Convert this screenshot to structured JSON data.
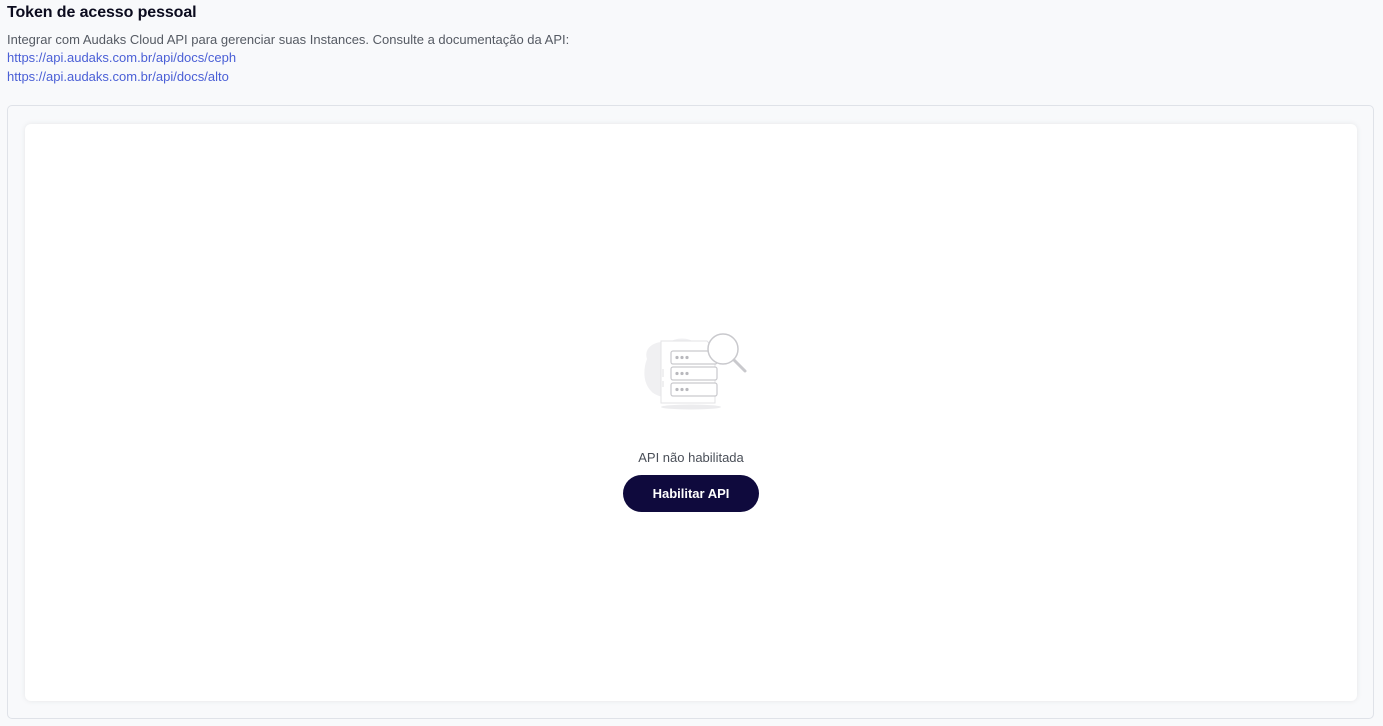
{
  "header": {
    "title": "Token de acesso pessoal",
    "description": "Integrar com Audaks Cloud API para gerenciar suas Instances. Consulte a documentação da API:",
    "links": [
      "https://api.audaks.com.br/api/docs/ceph",
      "https://api.audaks.com.br/api/docs/alto"
    ]
  },
  "empty_state": {
    "icon": "server-search-icon",
    "message": "API não habilitada",
    "button_label": "Habilitar API"
  },
  "colors": {
    "accent_button": "#0f0a3d",
    "link": "#4a5fd6",
    "background": "#f8f9fb"
  }
}
